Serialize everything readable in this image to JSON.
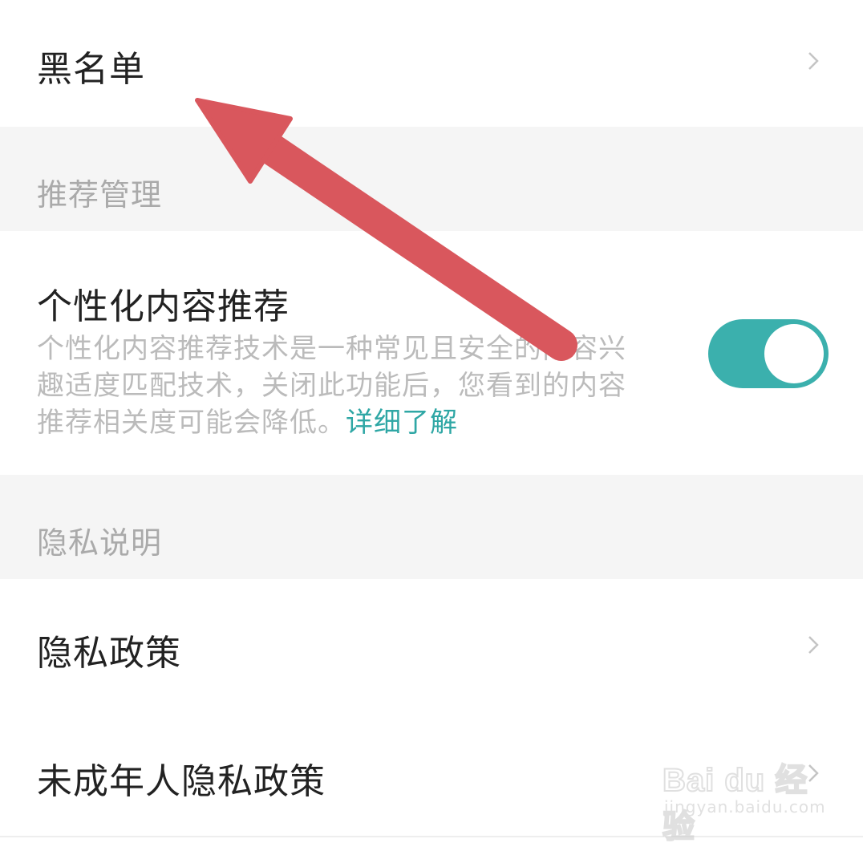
{
  "settings": {
    "blacklist": {
      "label": "黑名单"
    },
    "recommend_section": {
      "label": "推荐管理"
    },
    "personalized": {
      "title": "个性化内容推荐",
      "description": "个性化内容推荐技术是一种常见且安全的内容兴趣适度匹配技术，关闭此功能后，您看到的内容推荐相关度可能会降低。",
      "link": "详细了解",
      "enabled": true
    },
    "privacy_section": {
      "label": "隐私说明"
    },
    "privacy_policy": {
      "label": "隐私政策"
    },
    "minor_privacy_policy": {
      "label": "未成年人隐私政策"
    }
  },
  "colors": {
    "accent": "#3bb0ad",
    "link": "#2fa7a5",
    "section_bg": "#f5f5f5",
    "arrow": "#d9575d"
  },
  "icons": {
    "chevron": "chevron-right-icon",
    "arrow": "annotation-arrow"
  },
  "watermark": {
    "brand": "Bai du 经验",
    "url": "jingyan.baidu.com"
  }
}
